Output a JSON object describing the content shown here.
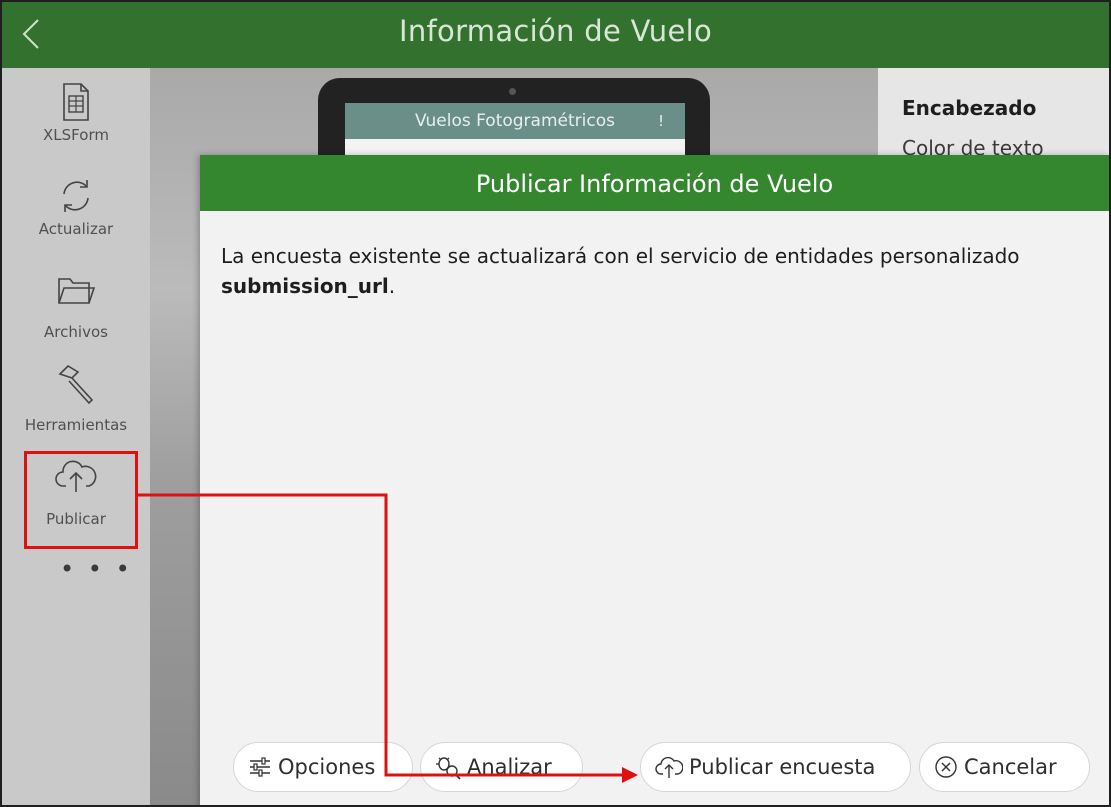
{
  "app": {
    "title": "Información de Vuelo"
  },
  "sidebar": {
    "items": [
      {
        "label": "XLSForm",
        "icon": "xlsform-file-icon"
      },
      {
        "label": "Actualizar",
        "icon": "refresh-icon"
      },
      {
        "label": "Archivos",
        "icon": "folder-icon"
      },
      {
        "label": "Herramientas",
        "icon": "hammer-icon"
      },
      {
        "label": "Publicar",
        "icon": "cloud-upload-icon"
      }
    ],
    "more": "• • •"
  },
  "preview": {
    "phone_title": "Vuelos Fotogramétricos",
    "phone_warning": "!",
    "panel_heading": "Encabezado",
    "panel_sub": "Color de texto"
  },
  "dialog": {
    "title": "Publicar Información de Vuelo",
    "message_text": "La encuesta existente se actualizará con el servicio de entidades personalizado",
    "message_bold": "submission_url",
    "message_end": ".",
    "buttons": {
      "options": "Opciones",
      "analyze": "Analizar",
      "publish": "Publicar encuesta",
      "cancel": "Cancelar"
    }
  },
  "colors": {
    "topbar": "#33712f",
    "dialog_header": "#35872f",
    "annotation": "#e01010"
  }
}
